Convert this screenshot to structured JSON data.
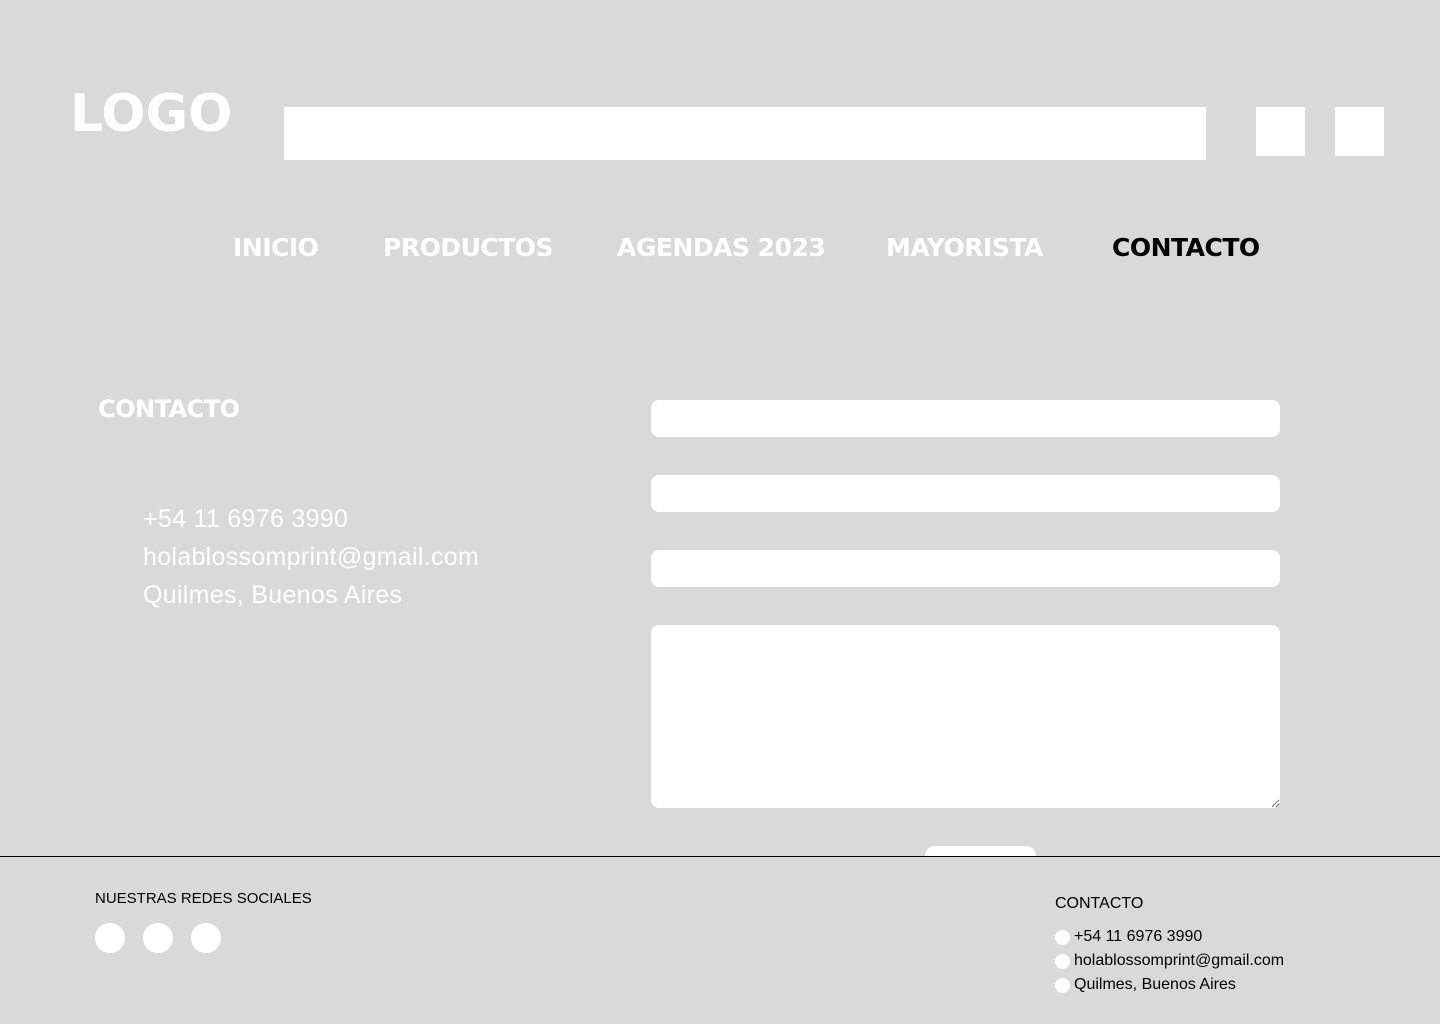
{
  "header": {
    "logo": "LOGO",
    "search_placeholder": "",
    "icons": [
      "user-icon",
      "cart-icon"
    ]
  },
  "nav": {
    "items": [
      {
        "label": "INICIO",
        "active": false
      },
      {
        "label": "PRODUCTOS",
        "active": false
      },
      {
        "label": "AGENDAS 2023",
        "active": false
      },
      {
        "label": "MAYORISTA",
        "active": false
      },
      {
        "label": "CONTACTO",
        "active": true
      }
    ]
  },
  "contact": {
    "title": "CONTACTO",
    "phone": "+54 11 6976 3990",
    "email": "holablossomprint@gmail.com",
    "location": "Quilmes, Buenos Aires"
  },
  "form": {
    "fields": [
      "",
      "",
      ""
    ],
    "message": "",
    "submit_label": ""
  },
  "footer": {
    "social_title": "NUESTRAS REDES SOCIALES",
    "social_icons": [
      "instagram-icon",
      "facebook-icon",
      "whatsapp-icon"
    ],
    "contact_title": "CONTACTO",
    "phone": "+54 11 6976 3990",
    "email": "holablossomprint@gmail.com",
    "location": "Quilmes, Buenos Aires"
  },
  "colors": {
    "background": "#d9d9d9",
    "foreground": "#ffffff",
    "active": "#000000"
  }
}
